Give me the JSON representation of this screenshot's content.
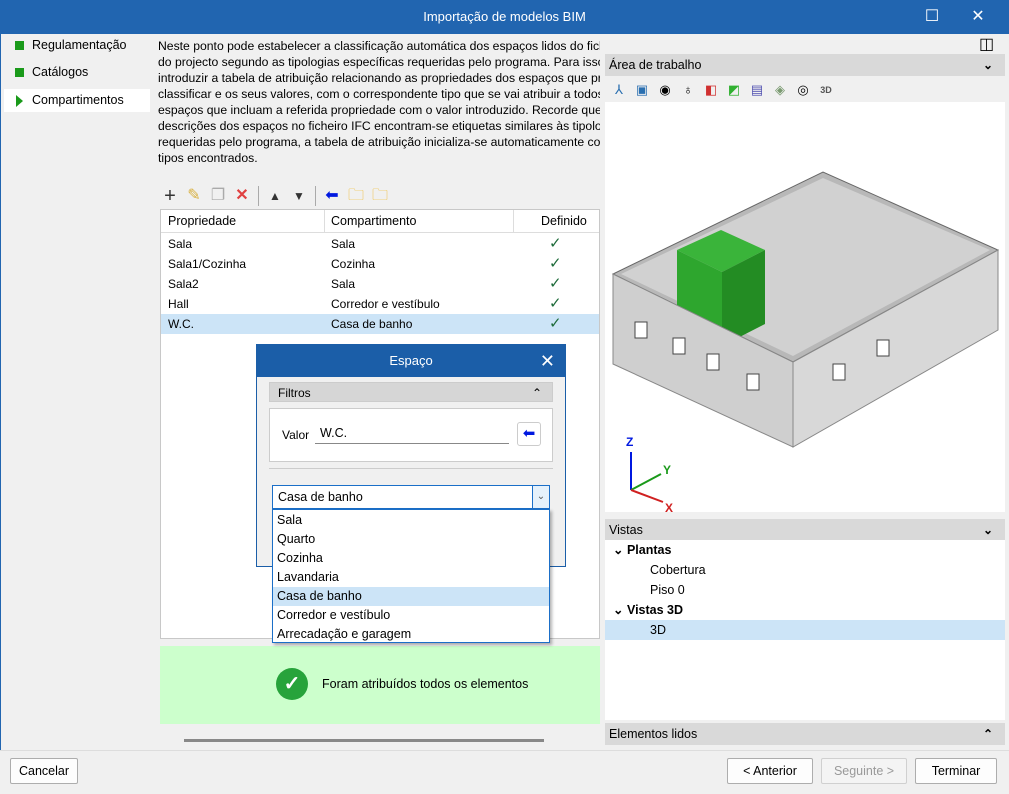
{
  "window": {
    "title": "Importação de modelos BIM",
    "maximize": "☐",
    "close": "✕"
  },
  "sidebar": {
    "items": [
      {
        "label": "Regulamentação"
      },
      {
        "label": "Catálogos"
      },
      {
        "label": "Compartimentos",
        "selected": true
      }
    ]
  },
  "main": {
    "description_lines": [
      "Neste ponto pode estabelecer a classificação automática dos espaços lidos do fiche",
      "do projecto segundo as tipologias específicas requeridas pelo programa. Para isso, ",
      "introduzir a tabela de atribuição relacionando as propriedades dos espaços que pret",
      "classificar e os seus valores, com o correspondente tipo que se vai atribuir a todos o",
      "espaços que incluam a referida propriedade com o valor introduzido. Recorde que s",
      "descrições dos espaços no ficheiro IFC encontram-se etiquetas similares às tipologi",
      "requeridas pelo programa, a tabela de atribuição inicializa-se automaticamente con",
      "tipos encontrados."
    ],
    "table": {
      "headers": [
        "Propriedade",
        "Compartimento",
        "Definido"
      ],
      "rows": [
        {
          "prop": "Sala",
          "comp": "Sala",
          "def": "✓"
        },
        {
          "prop": "Sala1/Cozinha",
          "comp": "Cozinha",
          "def": "✓"
        },
        {
          "prop": "Sala2",
          "comp": "Sala",
          "def": "✓"
        },
        {
          "prop": "Hall",
          "comp": "Corredor e vestíbulo",
          "def": "✓"
        },
        {
          "prop": "W.C.",
          "comp": "Casa de banho",
          "def": "✓",
          "selected": true
        }
      ]
    },
    "status": {
      "text": "Foram atribuídos todos os elementos",
      "color": "#ccffcc"
    }
  },
  "dialog": {
    "title": "Espaço",
    "filters_label": "Filtros",
    "valor_label": "Valor",
    "valor_value": "W.C.",
    "combo_value": "Casa de banho",
    "options": [
      "Sala",
      "Quarto",
      "Cozinha",
      "Lavandaria",
      "Casa de banho",
      "Corredor e vestíbulo",
      "Arrecadação e garagem"
    ],
    "selected_option": "Casa de banho"
  },
  "right": {
    "workarea_label": "Área de trabalho",
    "axes": {
      "z": "Z",
      "y": "Y",
      "x": "X"
    },
    "thumb_3d": "3D",
    "vistas_label": "Vistas",
    "tree": [
      {
        "label": "Plantas",
        "level": 0
      },
      {
        "label": "Cobertura",
        "level": 1
      },
      {
        "label": "Piso 0",
        "level": 1
      },
      {
        "label": "Vistas 3D",
        "level": 0
      },
      {
        "label": "3D",
        "level": 1,
        "selected": true
      }
    ],
    "elementos_label": "Elementos lidos"
  },
  "footer": {
    "cancel": "Cancelar",
    "previous": "< Anterior",
    "next": "Seguinte >",
    "finish": "Terminar"
  },
  "colors": {
    "titlebar": "#2165b0",
    "accent_green": "#1a9a1a",
    "selection": "#cce4f7"
  }
}
